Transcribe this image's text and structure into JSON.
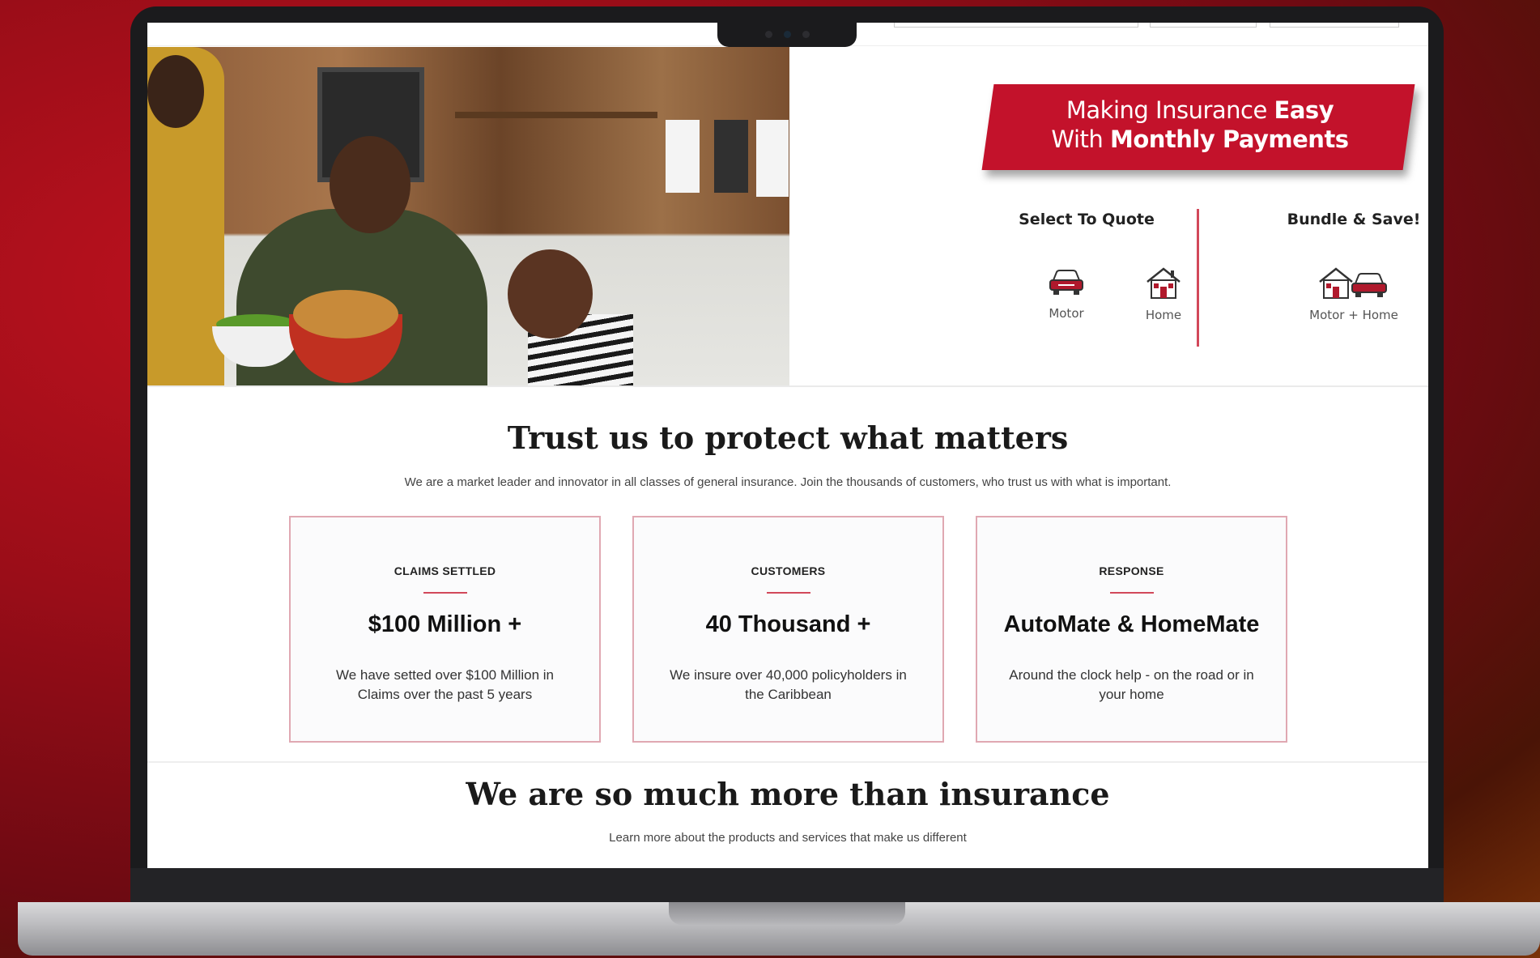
{
  "promo": {
    "line1_prefix": "Making Insurance ",
    "line1_bold": "Easy",
    "line2_prefix": "With ",
    "line2_bold": "Monthly Payments"
  },
  "quote": {
    "title": "Select To Quote",
    "options": [
      {
        "label": "Motor",
        "icon": "car-icon"
      },
      {
        "label": "Home",
        "icon": "house-icon"
      }
    ]
  },
  "bundle": {
    "title": "Bundle & Save!",
    "option": {
      "label": "Motor + Home",
      "icon": "house-car-icon"
    }
  },
  "trust": {
    "heading": "Trust us to protect what matters",
    "subheading": "We are a market leader and innovator in all classes of general insurance. Join the thousands of customers, who trust us with what is important."
  },
  "stats": [
    {
      "kicker": "CLAIMS SETTLED",
      "value": "$100 Million +",
      "description": "We have setted over $100 Million in Claims over the past 5 years"
    },
    {
      "kicker": "CUSTOMERS",
      "value": "40 Thousand +",
      "description": "We insure over 40,000 policyholders in the Caribbean"
    },
    {
      "kicker": "RESPONSE",
      "value": "AutoMate & HomeMate",
      "description": "Around the clock help - on the road or in your home"
    }
  ],
  "more": {
    "heading": "We are so much more than insurance",
    "subheading": "Learn more about the products and services that make us different"
  },
  "colors": {
    "brand_red": "#c3122b",
    "accent_rule": "#d2485a",
    "card_border": "#e0a8b2"
  }
}
